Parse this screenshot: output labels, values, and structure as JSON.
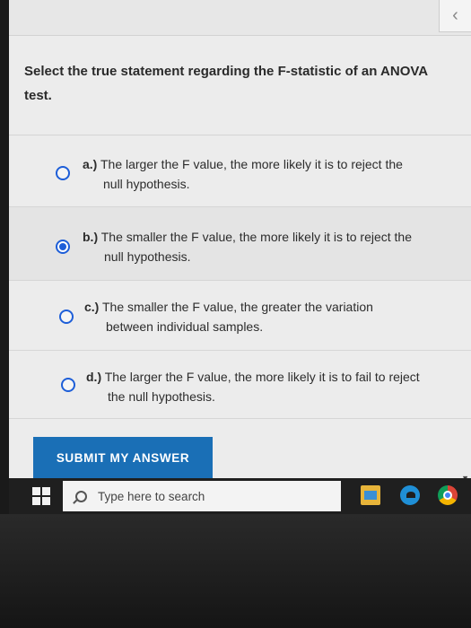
{
  "header": {
    "back_icon": "chevron-left-icon"
  },
  "question": {
    "text_line1": "Select the true statement regarding the F-statistic of an ANOVA",
    "text_line2": "test."
  },
  "options": [
    {
      "prefix": "a.)",
      "line1": "The larger the F value, the more likely it is to reject the",
      "line2": "null hypothesis.",
      "selected": false
    },
    {
      "prefix": "b.)",
      "line1": "The smaller the F value, the more likely it is to reject the",
      "line2": "null hypothesis.",
      "selected": true
    },
    {
      "prefix": "c.)",
      "line1": "The smaller the F value, the greater the variation",
      "line2": "between individual samples.",
      "selected": false
    },
    {
      "prefix": "d.)",
      "line1": "The larger the F value, the more likely it is to fail to reject",
      "line2": "the null hypothesis.",
      "selected": false
    }
  ],
  "submit": {
    "label": "SUBMIT MY ANSWER"
  },
  "taskbar": {
    "search_placeholder": "Type here to search",
    "icons": [
      "windows-start-icon",
      "search-icon",
      "file-explorer-icon",
      "edge-icon",
      "chrome-icon"
    ]
  },
  "colors": {
    "accent": "#1d5ed8",
    "submit_bg": "#1a6fb6",
    "taskbar_bg": "#1f1f1f"
  }
}
